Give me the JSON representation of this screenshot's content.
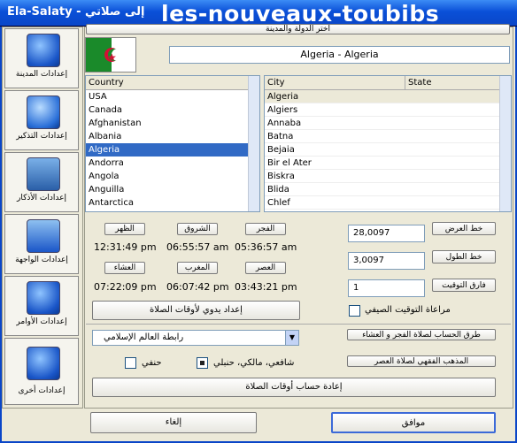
{
  "window": {
    "title": "Ela-Salaty - إلى صلاتي",
    "watermark": "les-nouveaux-toubibs"
  },
  "sidebar": {
    "items": [
      {
        "label": "إعدادات المدينة",
        "icon": "globe-icon"
      },
      {
        "label": "إعدادات التذكير",
        "icon": "speaker-icon"
      },
      {
        "label": "إعدادات الأذكار",
        "icon": "quran-icon"
      },
      {
        "label": "إعدادات الواجهة",
        "icon": "interface-icon"
      },
      {
        "label": "إعدادات الأوامر",
        "icon": "gear-icon"
      },
      {
        "label": "إعدادات أخرى",
        "icon": "tools-icon"
      }
    ]
  },
  "location": {
    "select_button": "اختر الدولة والمدينة",
    "selected_display": "Algeria - Algeria"
  },
  "country_list": {
    "header": "Country",
    "items": [
      "USA",
      "Canada",
      "Afghanistan",
      "Albania",
      "Algeria",
      "Andorra",
      "Angola",
      "Anguilla",
      "Antarctica"
    ],
    "selected": "Algeria"
  },
  "city_list": {
    "headers": [
      "City",
      "State"
    ],
    "items": [
      "Algeria",
      "Algiers",
      "Annaba",
      "Batna",
      "Bejaia",
      "Bir el Ater",
      "Biskra",
      "Blida",
      "Chlef"
    ],
    "selected": "Algeria"
  },
  "prayers": [
    {
      "name": "الظهر",
      "time": "12:31:49 pm"
    },
    {
      "name": "الشروق",
      "time": "06:55:57 am"
    },
    {
      "name": "الفجر",
      "time": "05:36:57 am"
    },
    {
      "name": "العشاء",
      "time": "07:22:09 pm"
    },
    {
      "name": "المغرب",
      "time": "06:07:42 pm"
    },
    {
      "name": "العصر",
      "time": "03:43:21 pm"
    }
  ],
  "manual_setup_button": "إعداد يدوي لأوقات الصلاة",
  "coords": {
    "latitude_label": "خط العرض",
    "latitude": "28,0097",
    "longitude_label": "خط الطول",
    "longitude": "3,0097",
    "timezone_label": "فارق التوقيت",
    "timezone": "1"
  },
  "dst_label": "مراعاة التوقيت الصيفي",
  "calc_method": {
    "select_value": "رابطة العالم الإسلامي",
    "fajr_isha_button": "طرق الحساب لصلاة الفجر و العشاء",
    "asr_button": "المذهب الفقهي لصلاة العصر",
    "hanafi_label": "حنفي",
    "shafii_label": "شافعي، مالكي، حنبلي",
    "recalc_button": "إعادة حساب أوقات الصلاة"
  },
  "footer": {
    "ok": "موافق",
    "cancel": "إلغاء"
  },
  "colors": {
    "title_blue": "#0a50d8",
    "selection": "#316ac5"
  }
}
